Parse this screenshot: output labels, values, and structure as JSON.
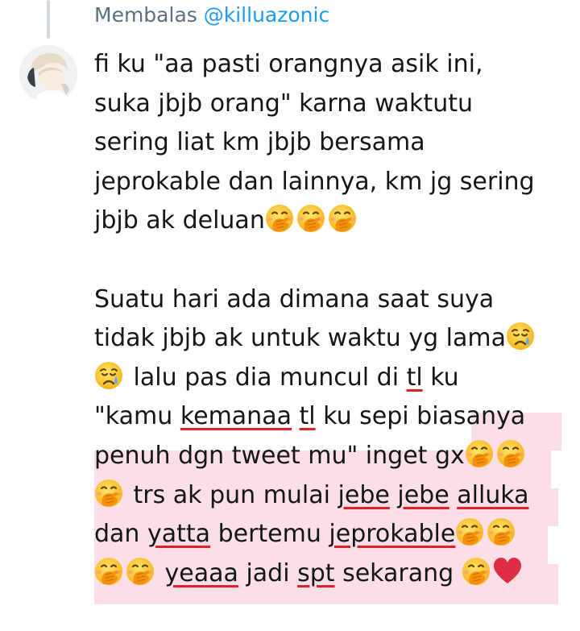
{
  "reply": {
    "prefix": "Membalas",
    "handle": "@killuazonic"
  },
  "tweet": {
    "lines": [
      [
        "fi ku \"aa pasti orangnya asik ini,"
      ],
      [
        "suka jbjb orang\" karna waktutu"
      ],
      [
        "sering liat km jbjb bersama"
      ],
      [
        "jeprokable dan lainnya, km jg sering"
      ],
      [
        "jbjb ak deluan"
      ],
      [
        ""
      ],
      [
        "Suatu hari ada dimana saat suya"
      ],
      [
        "tidak jbjb ak untuk waktu yg lama"
      ],
      [
        " lalu pas dia muncul di ",
        "tl",
        " ku"
      ],
      [
        "\"kamu ",
        "kemanaa",
        " ",
        "tl",
        " ku sepi biasanya"
      ],
      [
        "penuh dgn tweet mu\" inget gx"
      ],
      [
        " trs ak pun mulai ",
        "jebe",
        " ",
        "jebe",
        " ",
        "alluka"
      ],
      [
        "dan ",
        "yatta",
        " bertemu ",
        "jeprokable"
      ],
      [
        " ",
        "yeaaa",
        " jadi ",
        "spt",
        " sekarang "
      ]
    ]
  },
  "emoji": {
    "hand_over_mouth": "face-with-hand-over-mouth",
    "disappointed_relieved": "sad-but-relieved-face",
    "heart": "red-heart"
  },
  "colors": {
    "handle": "#1d9bf0",
    "text": "#14171a",
    "meta": "#5b7083",
    "highlight": "#f9d3dd",
    "spellcheck": "#e0202a"
  }
}
